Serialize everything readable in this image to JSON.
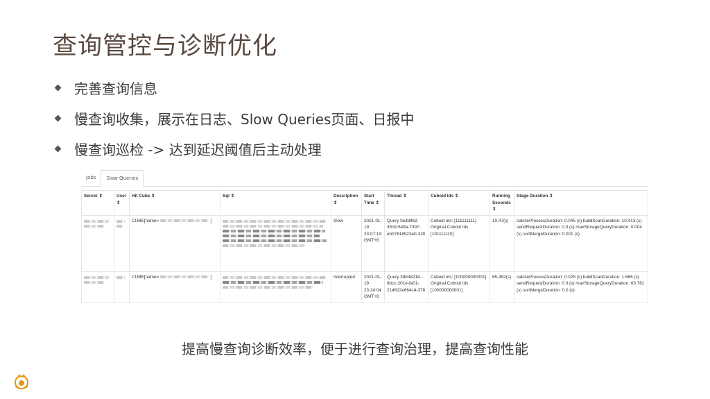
{
  "slide": {
    "title": "查询管控与诊断优化",
    "bullets": [
      "完善查询信息",
      "慢查询收集，展示在日志、Slow Queries页面、日报中",
      "慢查询巡检 -> 达到延迟阈值后主动处理"
    ],
    "summary": "提高慢查询诊断效率，便于进行查询治理，提高查询性能"
  },
  "screenshot": {
    "tabs": [
      "Jobs",
      "Slow Queries"
    ],
    "active_tab": "Slow Queries",
    "columns": [
      "Server ⇕",
      "User ⇕",
      "Hit Cube ⇕",
      "Sql ⇕",
      "Description ⇕",
      "Start Time ⇕",
      "Thread ⇕",
      "Cuboid Ids ⇕",
      "Running Seconds ⇕",
      "Stage Duration ⇕"
    ],
    "rows": [
      {
        "hit_cube": "CUBE[name=",
        "hit_cube_tail": "]",
        "description": "Slow",
        "start_time": "2021-01-19 23:07:19 GMT+8",
        "thread": "Query facb8f62-35c9-549a-7397-eb07618923e0-320",
        "cuboid_ids": "Cuboid Ids: [111111111] Original Cuboid Ids: [101111110]",
        "running_seconds": "10.47(s)",
        "stage_duration": "calciteProcessDuration: 0.045 (s) buildScanDuration: 10.413 (s) sendRequestDuration: 0.0 (s) maxStorageQueryDuration: 0.004 (s) sortMergeDuration: 0.001 (s)"
      },
      {
        "hit_cube": "CUBE[name=",
        "hit_cube_tail": "]",
        "description": "Interrupted",
        "start_time": "2021-01-19 23:24:04 GMT+8",
        "thread": "Query 38b48218-8bcc-201e-fa01-214622e664c4-378",
        "cuboid_ids": "Cuboid Ids: [100000000001] Original Cuboid Ids: [100000000001]",
        "running_seconds": "65.452(s)",
        "stage_duration": "calciteProcessDuration: 0.025 (s) buildScanDuration: 1.666 (s) sendRequestDuration: 0.0 (s) maxStorageQueryDuration: 63.761 (s) sortMergeDuration: 0.0 (s)"
      }
    ]
  },
  "logo_icon": "rabbit-logo-icon",
  "colors": {
    "title": "#5a4a42",
    "logo": "#e8941a"
  }
}
